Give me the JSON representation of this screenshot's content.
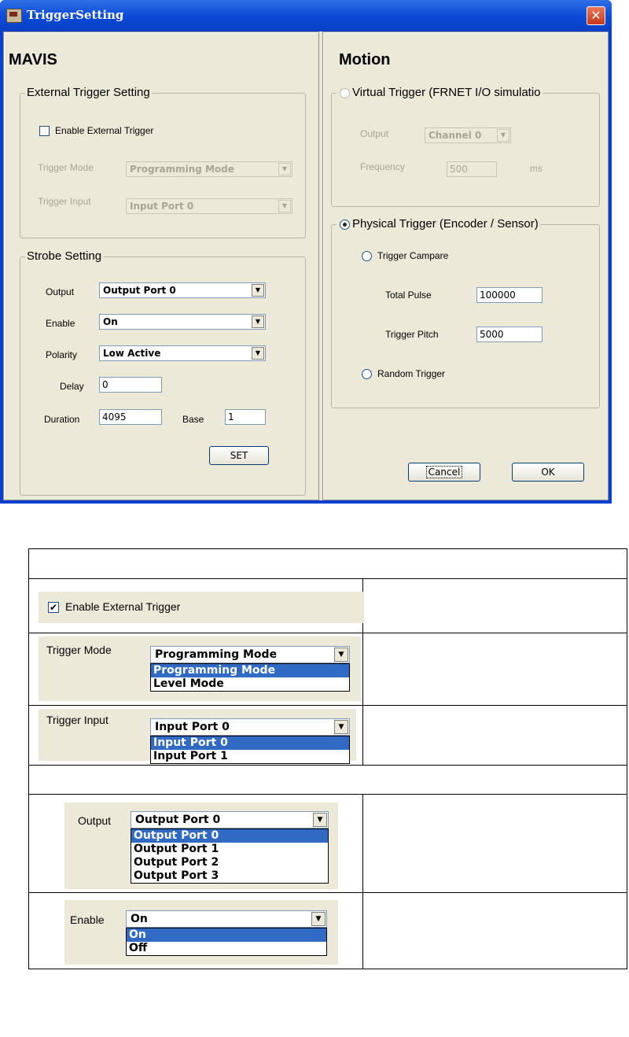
{
  "window": {
    "title": "TriggerSetting",
    "close_glyph": "✕"
  },
  "mavis": {
    "title": "MAVIS",
    "external": {
      "group_title": "External Trigger Setting",
      "enable_label": "Enable External Trigger",
      "enable_checked": false,
      "mode_label": "Trigger Mode",
      "mode_value": "Programming Mode",
      "input_label": "Trigger Input",
      "input_value": "Input Port 0"
    },
    "strobe": {
      "group_title": "Strobe Setting",
      "output_label": "Output",
      "output_value": "Output Port 0",
      "enable_label": "Enable",
      "enable_value": "On",
      "polarity_label": "Polarity",
      "polarity_value": "Low Active",
      "delay_label": "Delay",
      "delay_value": "0",
      "duration_label": "Duration",
      "duration_value": "4095",
      "base_label": "Base",
      "base_value": "1",
      "set_label": "SET"
    }
  },
  "motion": {
    "title": "Motion",
    "virtual": {
      "label": "Virtual Trigger (FRNET I/O simulatio",
      "selected": false,
      "output_label": "Output",
      "output_value": "Channel 0",
      "frequency_label": "Frequency",
      "frequency_value": "500",
      "frequency_unit": "ms"
    },
    "physical": {
      "label": "Physical Trigger (Encoder / Sensor)",
      "selected": true,
      "compare_label": "Trigger Campare",
      "total_pulse_label": "Total Pulse",
      "total_pulse_value": "100000",
      "pitch_label": "Trigger Pitch",
      "pitch_value": "5000",
      "random_label": "Random Trigger"
    },
    "cancel_label": "Cancel",
    "ok_label": "OK"
  },
  "table": {
    "enable_ext": {
      "label": "Enable External Trigger",
      "checked": true
    },
    "trigger_mode": {
      "label": "Trigger Mode",
      "value": "Programming Mode",
      "options": [
        "Programming Mode",
        "Level Mode"
      ]
    },
    "trigger_input": {
      "label": "Trigger Input",
      "value": "Input Port 0",
      "options": [
        "Input Port 0",
        "Input Port 1"
      ]
    },
    "output": {
      "label": "Output",
      "value": "Output Port 0",
      "options": [
        "Output Port 0",
        "Output Port 1",
        "Output Port 2",
        "Output Port 3"
      ]
    },
    "enable": {
      "label": "Enable",
      "value": "On",
      "options": [
        "On",
        "Off"
      ]
    }
  },
  "colors": {
    "titlebar": "#0b49d6",
    "dialog_bg": "#ece9d8",
    "selection": "#316ac5"
  },
  "icons": {
    "combo_arrow": "▼",
    "check": "✔"
  }
}
